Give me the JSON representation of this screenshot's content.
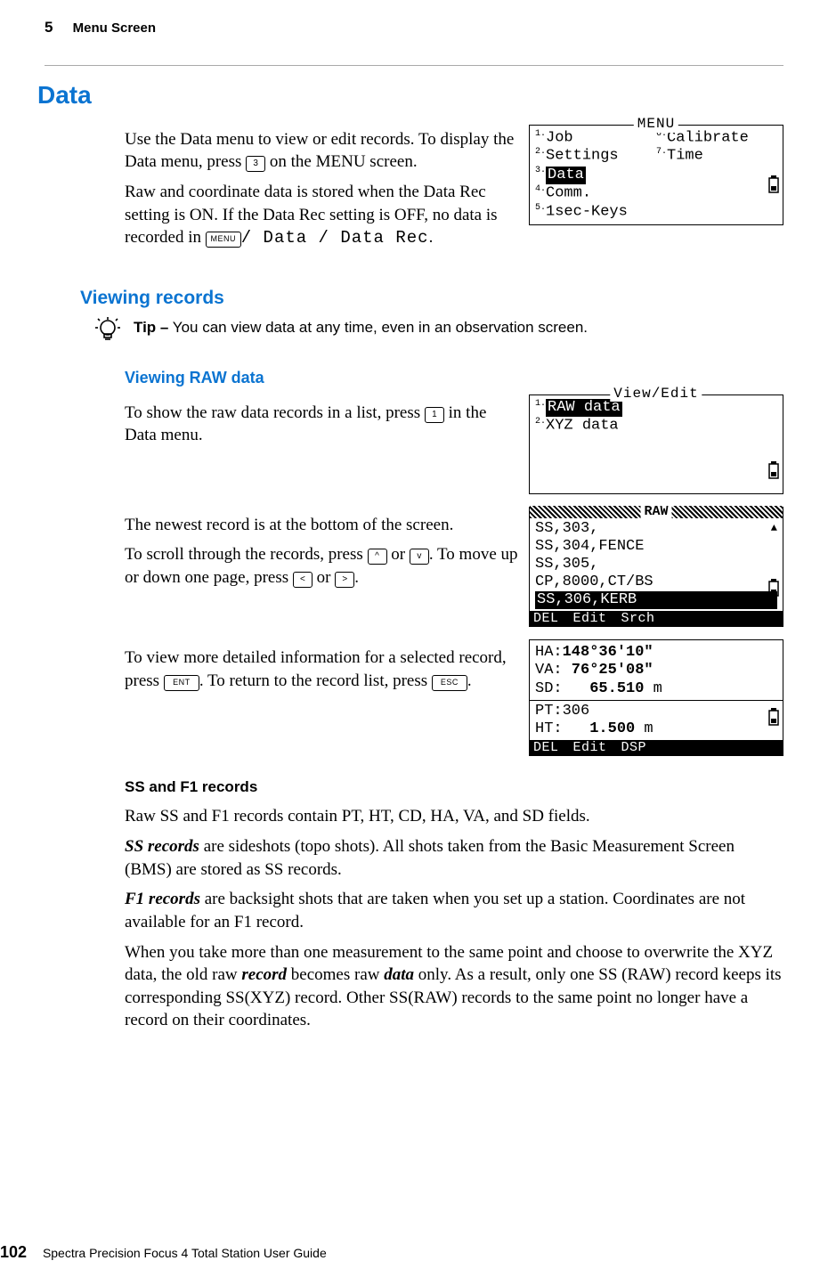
{
  "header": {
    "chapter_number": "5",
    "chapter_title": "Menu Screen"
  },
  "section": {
    "title": "Data"
  },
  "intro": {
    "p1a": "Use the Data menu to view or edit records. To display the Data menu, press ",
    "key3": "3",
    "p1b": " on the MENU screen.",
    "p2a": "Raw and coordinate data is stored when the Data Rec setting is ON. If the Data Rec setting is OFF, no data is recorded in ",
    "keyMenu": "MENU",
    "p2b": "/ Data / Data Rec",
    "p2c": "."
  },
  "menu_screen": {
    "title": "MENU",
    "left": [
      "Job",
      "Settings",
      "Data",
      "Comm.",
      "1sec-Keys"
    ],
    "right": [
      "Calibrate",
      "Time"
    ],
    "selected_index": 2
  },
  "viewing_records": {
    "title": "Viewing records",
    "tip_label": "Tip –",
    "tip_text": " You can view data at any time, even in an observation screen."
  },
  "viewing_raw": {
    "title": "Viewing RAW data",
    "p1a": "To show the raw data records in a list, press ",
    "key1": "1",
    "p1b": " in the Data menu."
  },
  "viewedit_screen": {
    "title": "View/Edit",
    "items": [
      "RAW data",
      "XYZ data"
    ],
    "selected_index": 0
  },
  "scroll": {
    "p1": "The newest record is at the bottom of the screen.",
    "p2a": "To scroll through the records, press ",
    "keyUp": "^",
    "or1": " or ",
    "keyDown": "v",
    "p2b": ". To move up or down one page, press ",
    "keyLeft": "<",
    "or2": " or ",
    "keyRight": ">",
    "p2c": "."
  },
  "raw_list_screen": {
    "title": "RAW",
    "rows": [
      "SS,303,",
      "SS,304,FENCE",
      "SS,305,",
      "CP,8000,CT/BS",
      "SS,306,KERB"
    ],
    "selected_index": 4,
    "footer": [
      "DEL",
      "Edit",
      "Srch"
    ]
  },
  "detail": {
    "p1a": "To view more detailed information for a selected record, press ",
    "keyEnt": "ENT",
    "p1b": ". To return to the record list, press ",
    "keyEsc": "ESC",
    "p1c": "."
  },
  "detail_screen": {
    "lines": [
      {
        "label": "HA:",
        "value": "148°36'10\""
      },
      {
        "label": "VA:",
        "value": " 76°25'08\""
      },
      {
        "label": "SD:",
        "value": "   65.510",
        "unit": " m"
      }
    ],
    "pt": "PT:306",
    "ht_label": "HT:",
    "ht_value": "   1.500",
    "ht_unit": " m",
    "footer": [
      "DEL",
      "Edit",
      "DSP"
    ]
  },
  "ssf1": {
    "heading": "SS and F1 records",
    "p1": "Raw SS and F1 records contain PT, HT, CD, HA, VA, and SD fields.",
    "p2_a": "SS records",
    "p2_b": " are sideshots (topo shots). All shots taken from the Basic Measurement Screen (BMS) are stored as SS records.",
    "p3_a": "F1 records",
    "p3_b": " are backsight shots that are taken when you set up a station. Coordinates are not available for an F1 record.",
    "p4_a": "When you take more than one measurement to the same point and choose to overwrite the XYZ data, the old raw ",
    "p4_b": "record",
    "p4_c": " becomes raw ",
    "p4_d": "data",
    "p4_e": " only. As a result, only one SS (RAW) record keeps its corresponding SS(XYZ) record. Other SS(RAW) records to the same point no longer have a record on their coordinates."
  },
  "footer": {
    "page": "102",
    "guide": "Spectra Precision Focus 4 Total Station User Guide"
  }
}
